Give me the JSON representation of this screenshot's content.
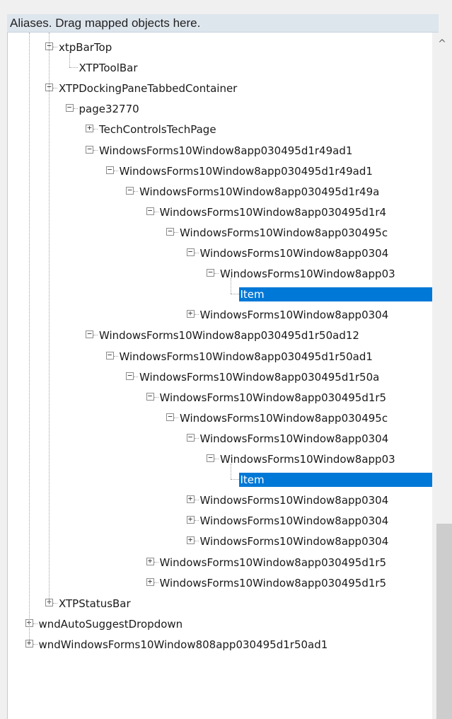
{
  "panel": {
    "header": "Aliases. Drag mapped objects here."
  },
  "tree": [
    {
      "depth": 2,
      "expander": "minus",
      "label": "xtpBarTop"
    },
    {
      "depth": 3,
      "expander": "none",
      "label": "XTPToolBar"
    },
    {
      "depth": 2,
      "expander": "minus",
      "label": "XTPDockingPaneTabbedContainer"
    },
    {
      "depth": 3,
      "expander": "minus",
      "label": "page32770"
    },
    {
      "depth": 4,
      "expander": "plus",
      "label": "TechControlsTechPage"
    },
    {
      "depth": 4,
      "expander": "minus",
      "label": "WindowsForms10Window8app030495d1r49ad1"
    },
    {
      "depth": 5,
      "expander": "minus",
      "label": "WindowsForms10Window8app030495d1r49ad1"
    },
    {
      "depth": 6,
      "expander": "minus",
      "label": "WindowsForms10Window8app030495d1r49a"
    },
    {
      "depth": 7,
      "expander": "minus",
      "label": "WindowsForms10Window8app030495d1r4"
    },
    {
      "depth": 8,
      "expander": "minus",
      "label": "WindowsForms10Window8app030495c"
    },
    {
      "depth": 9,
      "expander": "minus",
      "label": "WindowsForms10Window8app0304"
    },
    {
      "depth": 10,
      "expander": "minus",
      "label": "WindowsForms10Window8app03"
    },
    {
      "depth": 11,
      "expander": "none",
      "label": "Item",
      "selected": true
    },
    {
      "depth": 9,
      "expander": "plus",
      "label": "WindowsForms10Window8app0304"
    },
    {
      "depth": 4,
      "expander": "minus",
      "label": "WindowsForms10Window8app030495d1r50ad12"
    },
    {
      "depth": 5,
      "expander": "minus",
      "label": "WindowsForms10Window8app030495d1r50ad1"
    },
    {
      "depth": 6,
      "expander": "minus",
      "label": "WindowsForms10Window8app030495d1r50a"
    },
    {
      "depth": 7,
      "expander": "minus",
      "label": "WindowsForms10Window8app030495d1r5"
    },
    {
      "depth": 8,
      "expander": "minus",
      "label": "WindowsForms10Window8app030495c"
    },
    {
      "depth": 9,
      "expander": "minus",
      "label": "WindowsForms10Window8app0304"
    },
    {
      "depth": 10,
      "expander": "minus",
      "label": "WindowsForms10Window8app03"
    },
    {
      "depth": 11,
      "expander": "none",
      "label": "Item",
      "selected": true
    },
    {
      "depth": 9,
      "expander": "plus",
      "label": "WindowsForms10Window8app0304"
    },
    {
      "depth": 9,
      "expander": "plus",
      "label": "WindowsForms10Window8app0304"
    },
    {
      "depth": 9,
      "expander": "plus",
      "label": "WindowsForms10Window8app0304"
    },
    {
      "depth": 7,
      "expander": "plus",
      "label": "WindowsForms10Window8app030495d1r5"
    },
    {
      "depth": 7,
      "expander": "plus",
      "label": "WindowsForms10Window8app030495d1r5"
    },
    {
      "depth": 2,
      "expander": "plus",
      "label": "XTPStatusBar"
    },
    {
      "depth": 1,
      "expander": "plus",
      "label": "wndAutoSuggestDropdown"
    },
    {
      "depth": 1,
      "expander": "plus",
      "label": "wndWindowsForms10Window808app030495d1r50ad1"
    }
  ],
  "icons": {
    "expand": "plus-box-icon",
    "collapse": "minus-box-icon",
    "scroll_up": "chevron-up-icon"
  },
  "colors": {
    "selection": "#0078d7",
    "header_bg": "#dde5ed"
  }
}
